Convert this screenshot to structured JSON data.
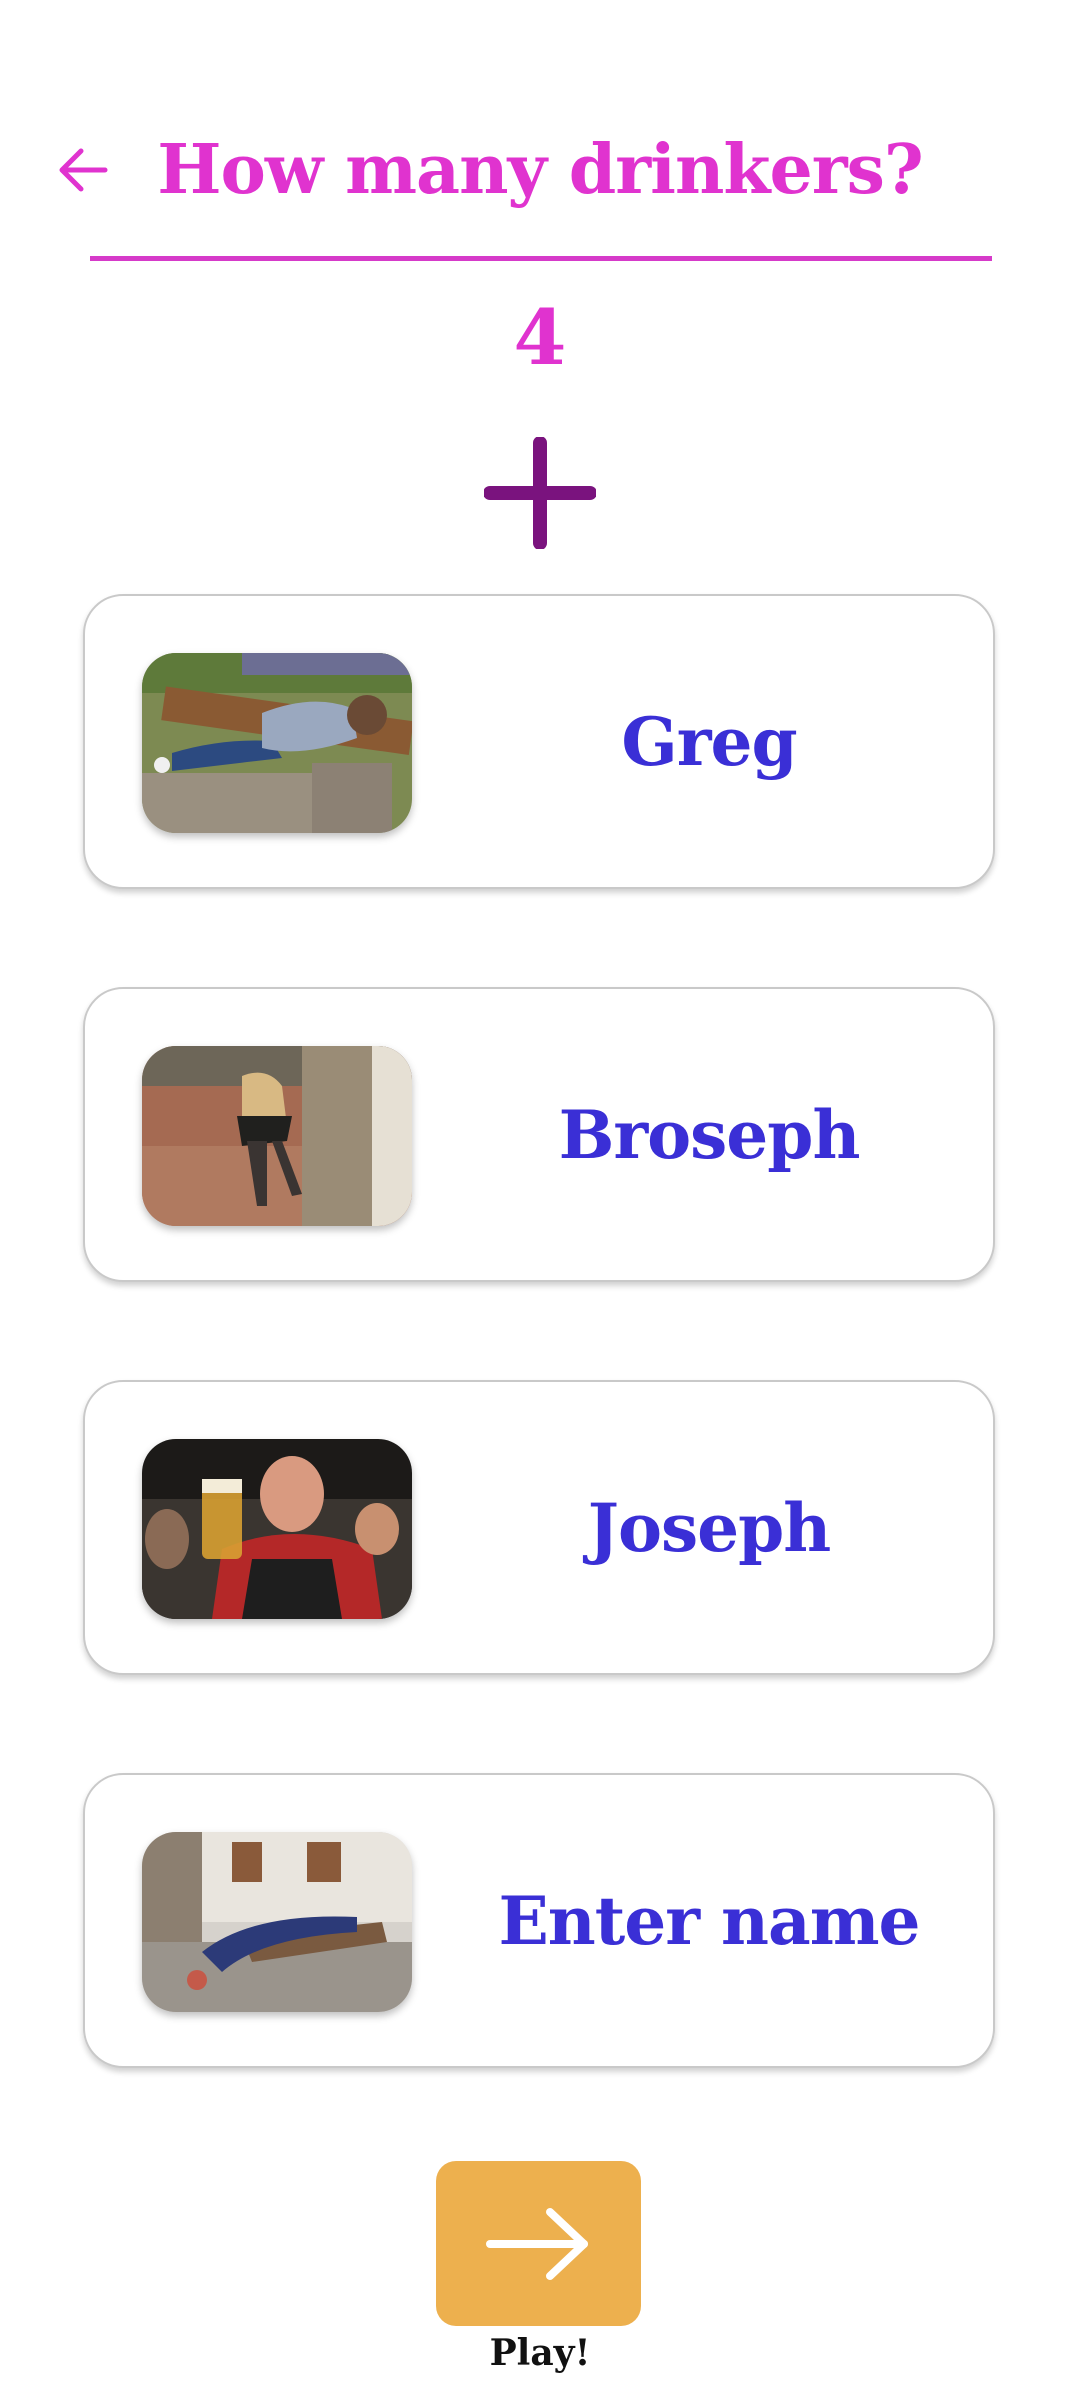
{
  "header": {
    "title": "How many drinkers?",
    "back_icon": "arrow-left-icon"
  },
  "counter": {
    "value": "4",
    "add_icon": "plus-icon"
  },
  "players": [
    {
      "name": "Greg",
      "photo": "player-photo-passed-out-on-bench"
    },
    {
      "name": "Broseph",
      "photo": "player-photo-stumbling-by-pillar"
    },
    {
      "name": "Joseph",
      "photo": "player-photo-holding-beer-mug"
    },
    {
      "name": "Enter name",
      "photo": "player-photo-head-down-on-bench"
    }
  ],
  "footer": {
    "play_label": "Play!",
    "play_icon": "arrow-right-icon"
  },
  "colors": {
    "title": "#e033cf",
    "add": "#7a137e",
    "name": "#3a2fd6",
    "play_button": "#edb04e",
    "play_label": "#111111"
  }
}
